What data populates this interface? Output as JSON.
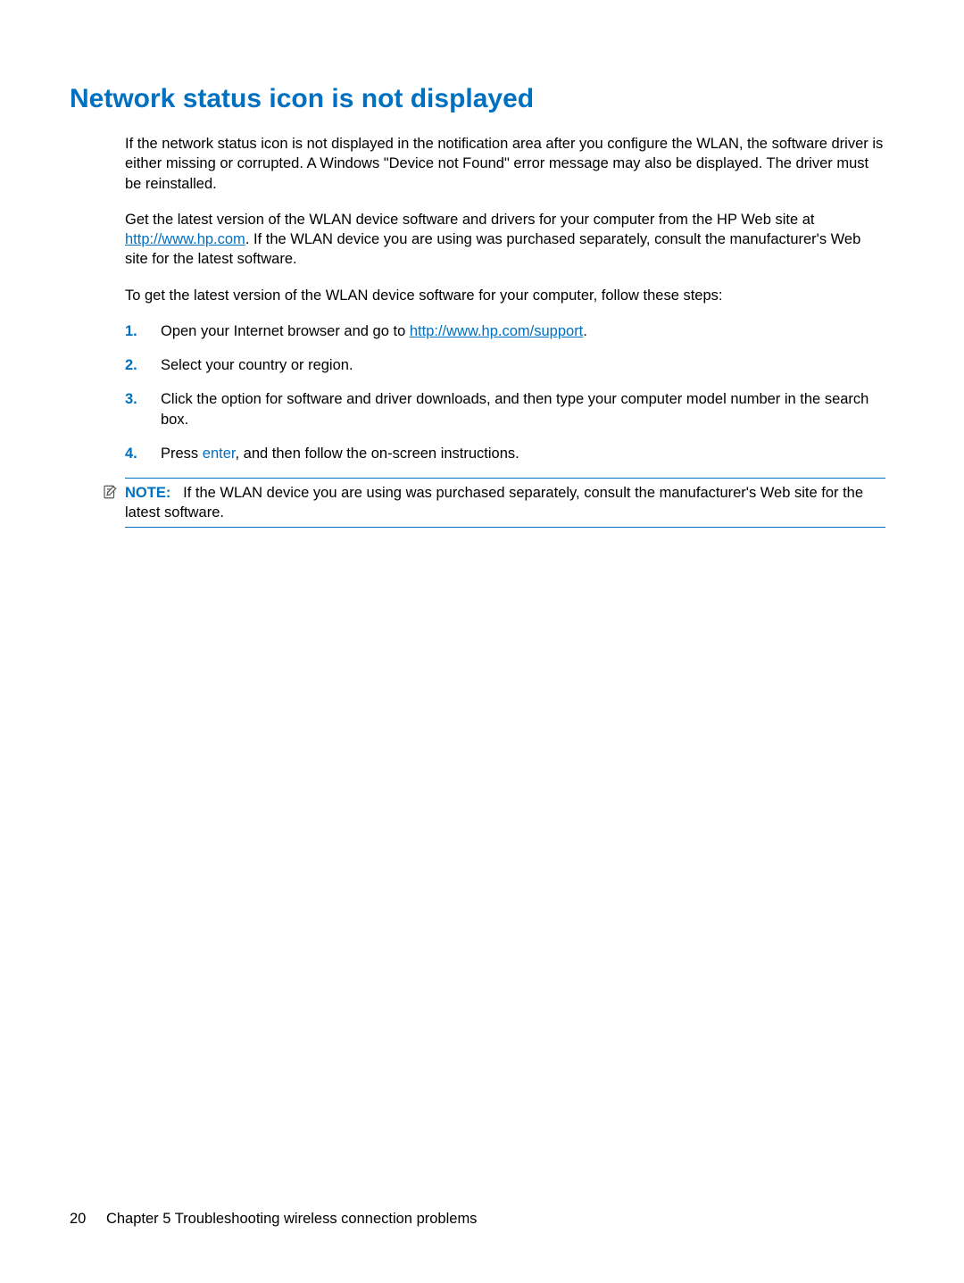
{
  "heading": "Network status icon is not displayed",
  "para1": "If the network status icon is not displayed in the notification area after you configure the WLAN, the software driver is either missing or corrupted. A Windows \"Device not Found\" error message may also be displayed. The driver must be reinstalled.",
  "para2_pre": "Get the latest version of the WLAN device software and drivers for your computer from the HP Web site at ",
  "para2_link": "http://www.hp.com",
  "para2_post": ". If the WLAN device you are using was purchased separately, consult the manufacturer's Web site for the latest software.",
  "para3": "To get the latest version of the WLAN device software for your computer, follow these steps:",
  "steps": {
    "n1": "1.",
    "s1_pre": "Open your Internet browser and go to ",
    "s1_link": "http://www.hp.com/support",
    "s1_post": ".",
    "n2": "2.",
    "s2": "Select your country or region.",
    "n3": "3.",
    "s3": "Click the option for software and driver downloads, and then type your computer model number in the search box.",
    "n4": "4.",
    "s4_pre": "Press ",
    "s4_kbd": "enter",
    "s4_post": ", and then follow the on-screen instructions."
  },
  "note": {
    "label": "NOTE:",
    "text": "If the WLAN device you are using was purchased separately, consult the manufacturer's Web site for the latest software."
  },
  "footer": {
    "page": "20",
    "chapter": "Chapter 5   Troubleshooting wireless connection problems"
  }
}
